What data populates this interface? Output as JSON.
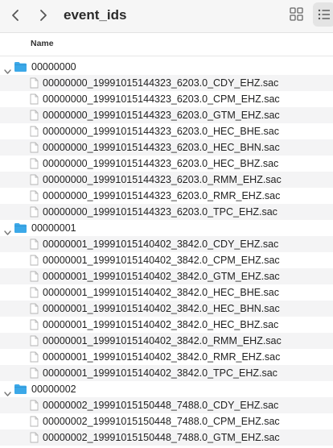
{
  "window": {
    "title": "event_ids"
  },
  "toolbar": {
    "back_icon": "chevron-left-icon",
    "forward_icon": "chevron-right-icon",
    "grid_view_icon": "grid-view-icon",
    "list_view_icon": "list-view-icon"
  },
  "columns": {
    "name": "Name"
  },
  "colors": {
    "folder": "#3ba8e8",
    "row_alt": "#f4f4f5",
    "toolbar_bg": "#f6f6f6"
  },
  "rows": [
    {
      "type": "folder",
      "label": "00000000"
    },
    {
      "type": "file",
      "label": "00000000_19991015144323_6203.0_CDY_EHZ.sac"
    },
    {
      "type": "file",
      "label": "00000000_19991015144323_6203.0_CPM_EHZ.sac"
    },
    {
      "type": "file",
      "label": "00000000_19991015144323_6203.0_GTM_EHZ.sac"
    },
    {
      "type": "file",
      "label": "00000000_19991015144323_6203.0_HEC_BHE.sac"
    },
    {
      "type": "file",
      "label": "00000000_19991015144323_6203.0_HEC_BHN.sac"
    },
    {
      "type": "file",
      "label": "00000000_19991015144323_6203.0_HEC_BHZ.sac"
    },
    {
      "type": "file",
      "label": "00000000_19991015144323_6203.0_RMM_EHZ.sac"
    },
    {
      "type": "file",
      "label": "00000000_19991015144323_6203.0_RMR_EHZ.sac"
    },
    {
      "type": "file",
      "label": "00000000_19991015144323_6203.0_TPC_EHZ.sac"
    },
    {
      "type": "folder",
      "label": "00000001"
    },
    {
      "type": "file",
      "label": "00000001_19991015140402_3842.0_CDY_EHZ.sac"
    },
    {
      "type": "file",
      "label": "00000001_19991015140402_3842.0_CPM_EHZ.sac"
    },
    {
      "type": "file",
      "label": "00000001_19991015140402_3842.0_GTM_EHZ.sac"
    },
    {
      "type": "file",
      "label": "00000001_19991015140402_3842.0_HEC_BHE.sac"
    },
    {
      "type": "file",
      "label": "00000001_19991015140402_3842.0_HEC_BHN.sac"
    },
    {
      "type": "file",
      "label": "00000001_19991015140402_3842.0_HEC_BHZ.sac"
    },
    {
      "type": "file",
      "label": "00000001_19991015140402_3842.0_RMM_EHZ.sac"
    },
    {
      "type": "file",
      "label": "00000001_19991015140402_3842.0_RMR_EHZ.sac"
    },
    {
      "type": "file",
      "label": "00000001_19991015140402_3842.0_TPC_EHZ.sac"
    },
    {
      "type": "folder",
      "label": "00000002"
    },
    {
      "type": "file",
      "label": "00000002_19991015150448_7488.0_CDY_EHZ.sac"
    },
    {
      "type": "file",
      "label": "00000002_19991015150448_7488.0_CPM_EHZ.sac"
    },
    {
      "type": "file",
      "label": "00000002_19991015150448_7488.0_GTM_EHZ.sac"
    }
  ]
}
